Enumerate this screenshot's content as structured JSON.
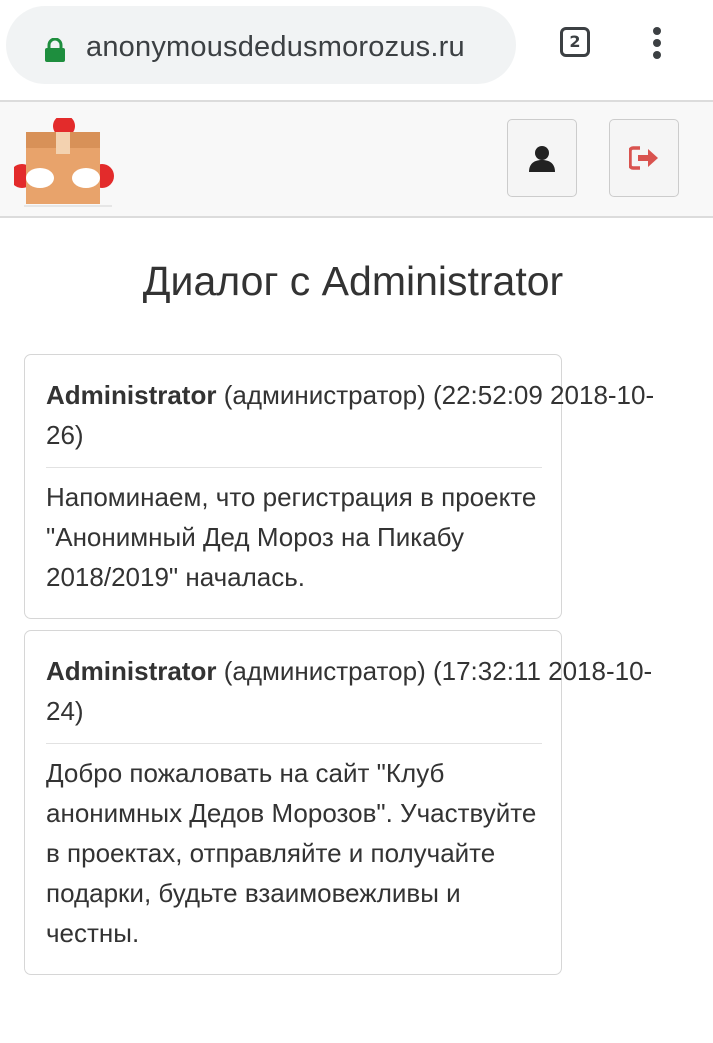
{
  "browser": {
    "url": "anonymousdedusmorozus.ru",
    "tab_count": "2",
    "icons": [
      "lock-icon",
      "tab-switcher-icon",
      "more-vert-icon"
    ],
    "lock_color": "#1e8e3e"
  },
  "navbar": {
    "icons": [
      "site-logo",
      "user-icon",
      "logout-icon"
    ],
    "logout_color": "#d9534f"
  },
  "page": {
    "title": "Диалог с Administrator"
  },
  "messages": [
    {
      "author": "Administrator",
      "role": "(администратор)",
      "timestamp": "(22:52:09 2018-10-26)",
      "text": "Напоминаем, что регистрация в проекте \"Анонимный Дед Мороз на Пикабу 2018/2019\" началась."
    },
    {
      "author": "Administrator",
      "role": "(администратор)",
      "timestamp": "(17:32:11 2018-10-24)",
      "text": "Добро пожаловать на сайт \"Клуб анонимных Дедов Морозов\". Участвуйте в проектах, отправляйте и получайте подарки, будьте взаимовежливы и честны."
    }
  ]
}
